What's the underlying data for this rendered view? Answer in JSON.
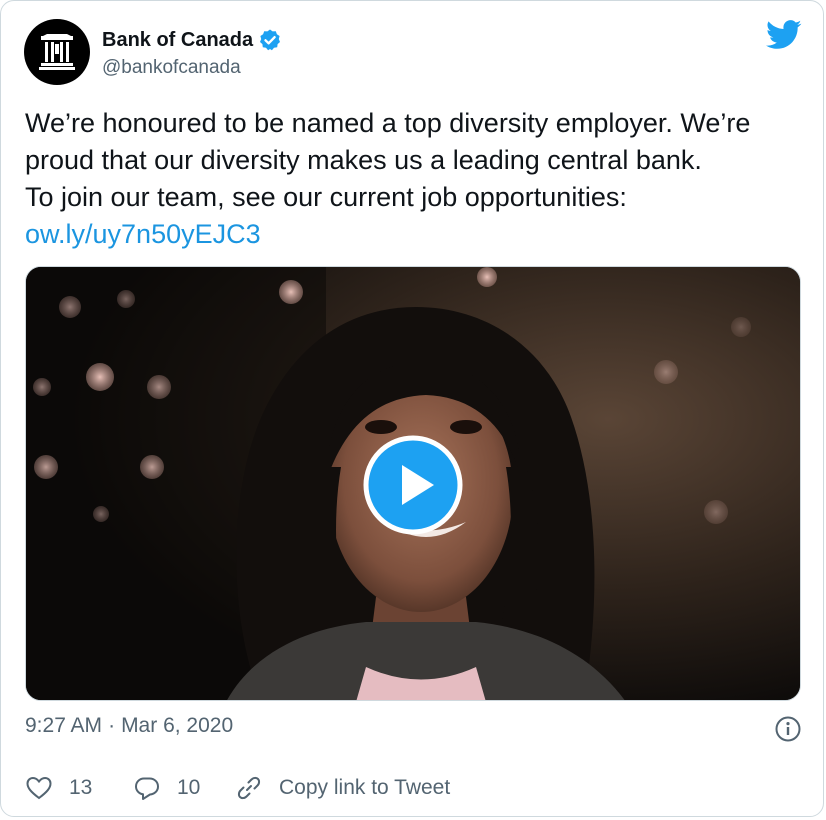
{
  "account": {
    "name": "Bank of Canada",
    "handle": "@bankofcanada",
    "verified": true
  },
  "tweet": {
    "lines": [
      "We’re honoured to be named a top diversity employer. We’re",
      "proud that our diversity makes us a leading central bank.",
      "To join our team, see our current job opportunities:"
    ],
    "link": "ow.ly/uy7n50yEJC3"
  },
  "media": {
    "type": "video",
    "play_icon": "play-icon"
  },
  "meta": {
    "time": "9:27 AM",
    "separator": "·",
    "date": "Mar 6, 2020"
  },
  "actions": {
    "likes": "13",
    "replies": "10",
    "copy_link_label": "Copy link to Tweet"
  },
  "colors": {
    "accent": "#1da1f2",
    "link": "#1b95e0",
    "secondary_text": "#536471",
    "border": "#cfd9de"
  },
  "icons": [
    "bank-logo-icon",
    "verified-badge-icon",
    "twitter-bird-icon",
    "play-icon",
    "info-icon",
    "heart-icon",
    "reply-icon",
    "link-icon"
  ]
}
